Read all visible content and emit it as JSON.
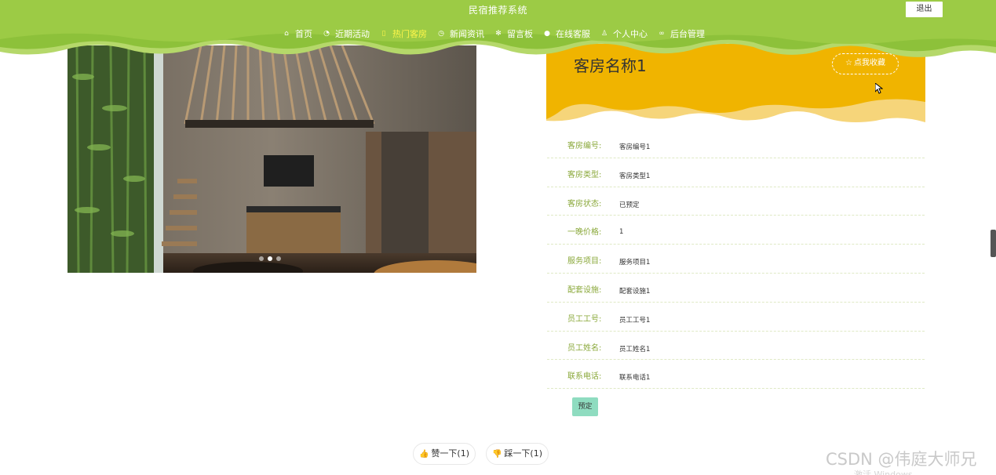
{
  "header": {
    "site_title": "民宿推荐系统",
    "logout_label": "退出",
    "nav": [
      {
        "label": "首页",
        "icon": "home-icon",
        "glyph": "⌂",
        "active": false
      },
      {
        "label": "近期活动",
        "icon": "palette-icon",
        "glyph": "◔",
        "active": false
      },
      {
        "label": "热门客房",
        "icon": "bookmark-icon",
        "glyph": "▯",
        "active": true
      },
      {
        "label": "新闻资讯",
        "icon": "clock-icon",
        "glyph": "◷",
        "active": false
      },
      {
        "label": "留言板",
        "icon": "snowflake-icon",
        "glyph": "✻",
        "active": false
      },
      {
        "label": "在线客服",
        "icon": "compass-icon",
        "glyph": "●",
        "active": false
      },
      {
        "label": "个人中心",
        "icon": "user-icon",
        "glyph": "♙",
        "active": false
      },
      {
        "label": "后台管理",
        "icon": "link-icon",
        "glyph": "∞",
        "active": false
      }
    ]
  },
  "room": {
    "name": "客房名称1",
    "favorite_label": "点我收藏",
    "favorite_icon": "star-icon",
    "fields": [
      {
        "label": "客房编号:",
        "value": "客房编号1"
      },
      {
        "label": "客房类型:",
        "value": "客房类型1"
      },
      {
        "label": "客房状态:",
        "value": "已预定"
      },
      {
        "label": "一晚价格:",
        "value": "1"
      },
      {
        "label": "服务项目:",
        "value": "服务项目1"
      },
      {
        "label": "配套设施:",
        "value": "配套设施1"
      },
      {
        "label": "员工工号:",
        "value": "员工工号1"
      },
      {
        "label": "员工姓名:",
        "value": "员工姓名1"
      },
      {
        "label": "联系电话:",
        "value": "联系电话1"
      }
    ],
    "book_label": "预定",
    "carousel_slides": 3,
    "carousel_active": 1
  },
  "votes": {
    "like_label": "赞一下(1)",
    "like_icon": "thumbs-up-icon",
    "dislike_label": "踩一下(1)",
    "dislike_icon": "thumbs-down-icon"
  },
  "overlay": {
    "watermark": "CSDN @伟庭大师兄",
    "activate_text": "激活 Windows"
  },
  "colors": {
    "header_green": "#8dc13a",
    "header_light": "#b5d86a",
    "title_band": "#f0b400",
    "label_green": "#8aa83a",
    "book_button": "#8fdcc0",
    "nav_active": "#fff64a"
  }
}
